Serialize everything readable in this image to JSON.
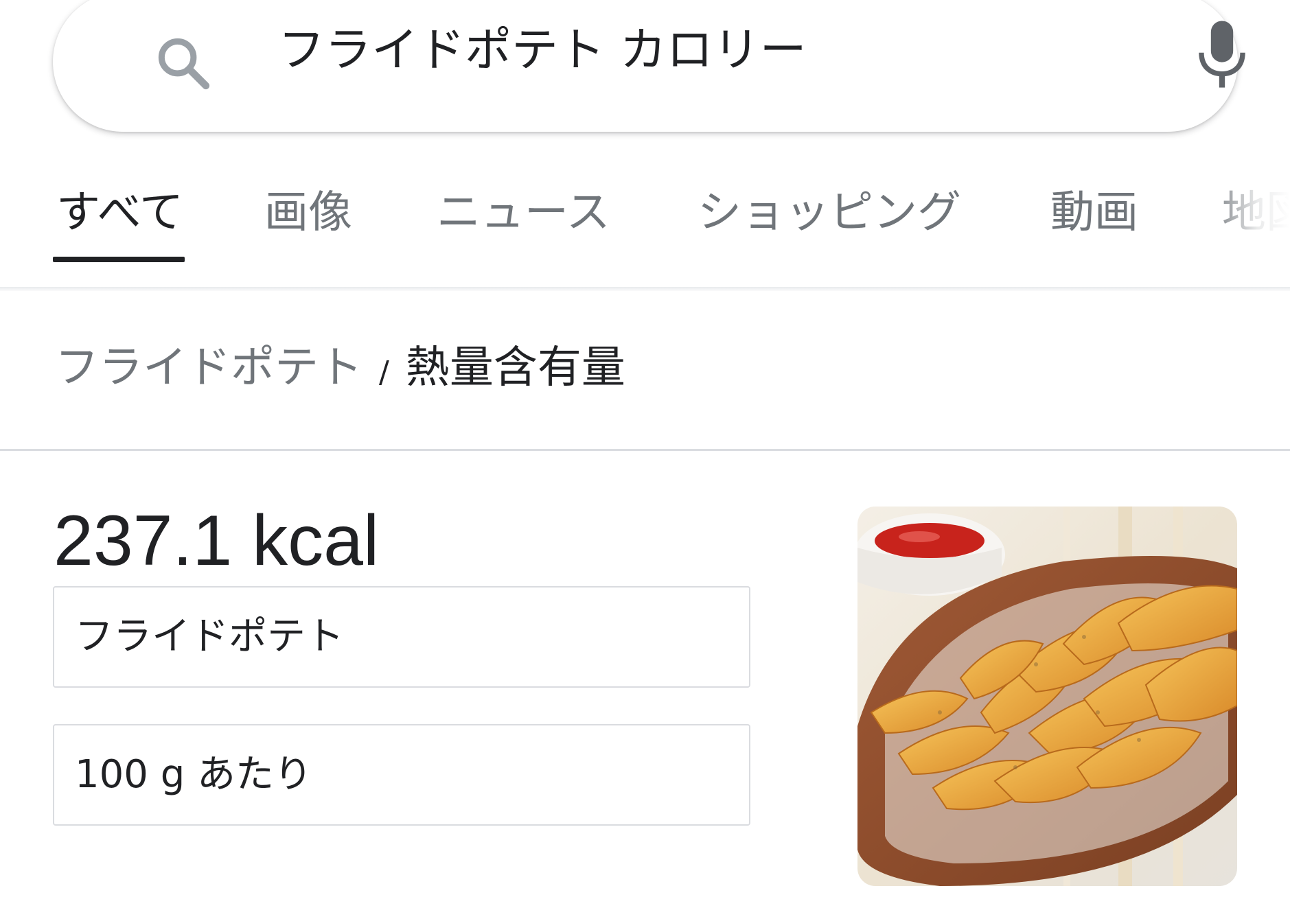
{
  "search": {
    "query": "フライドポテト カロリー",
    "icon": "search-icon",
    "voice_icon": "mic-icon"
  },
  "tabs": [
    {
      "label": "すべて",
      "active": true
    },
    {
      "label": "画像"
    },
    {
      "label": "ニュース"
    },
    {
      "label": "ショッピング"
    },
    {
      "label": "動画"
    },
    {
      "label": "地図"
    }
  ],
  "breadcrumb": {
    "parent": "フライドポテト",
    "separator": "/",
    "current": "熱量含有量"
  },
  "result": {
    "calories": "237.1 kcal",
    "food_select": "フライドポテト",
    "amount_select": "100 g あたり",
    "image": "fried-potato-wedges-photo"
  },
  "colors": {
    "text_primary": "#202124",
    "text_secondary": "#70757a",
    "divider": "#dadce0"
  }
}
